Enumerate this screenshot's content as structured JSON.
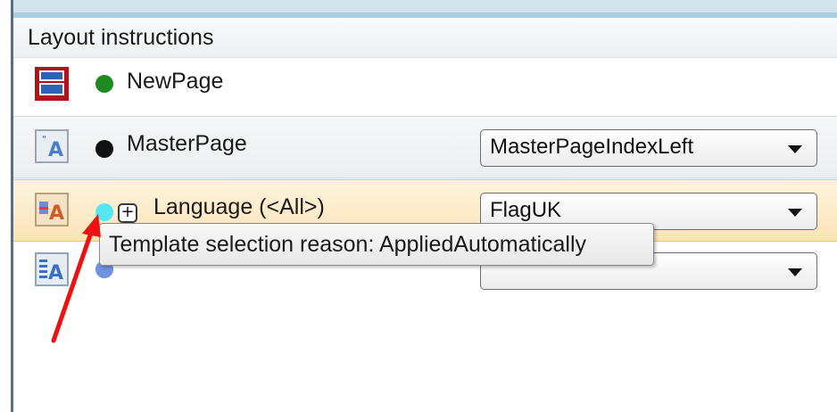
{
  "panel": {
    "title": "Layout instructions",
    "rows": [
      {
        "label": "NewPage",
        "dot_color": "#1f8a1f",
        "icon": "newpage-icon"
      },
      {
        "label": "MasterPage",
        "dot_color": "#111111",
        "icon": "masterpage-icon",
        "selected_value": "MasterPageIndexLeft"
      },
      {
        "label": "Language (<All>)",
        "dot_color": "#55e6f2",
        "icon": "language-template-icon",
        "expander": "+",
        "selected_value": "FlagUK"
      },
      {
        "dot_color": "#6d93e0",
        "icon": "template-icon",
        "selected_value": ""
      }
    ]
  },
  "tooltip": {
    "text": "Template selection reason: AppliedAutomatically"
  },
  "colors": {
    "highlight_row": "#fbe3b7",
    "annotation_arrow": "#ee1111"
  }
}
